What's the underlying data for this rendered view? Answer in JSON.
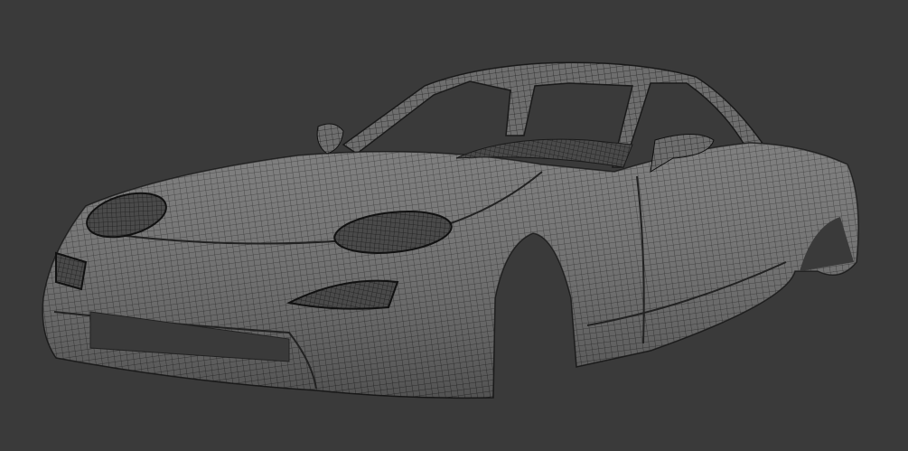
{
  "viewport": {
    "background_color": "#3a3a3a",
    "mesh_fill_color": "#6e6e6e",
    "mesh_line_color": "#1e1e1e",
    "object": "car-body-wireframe"
  }
}
